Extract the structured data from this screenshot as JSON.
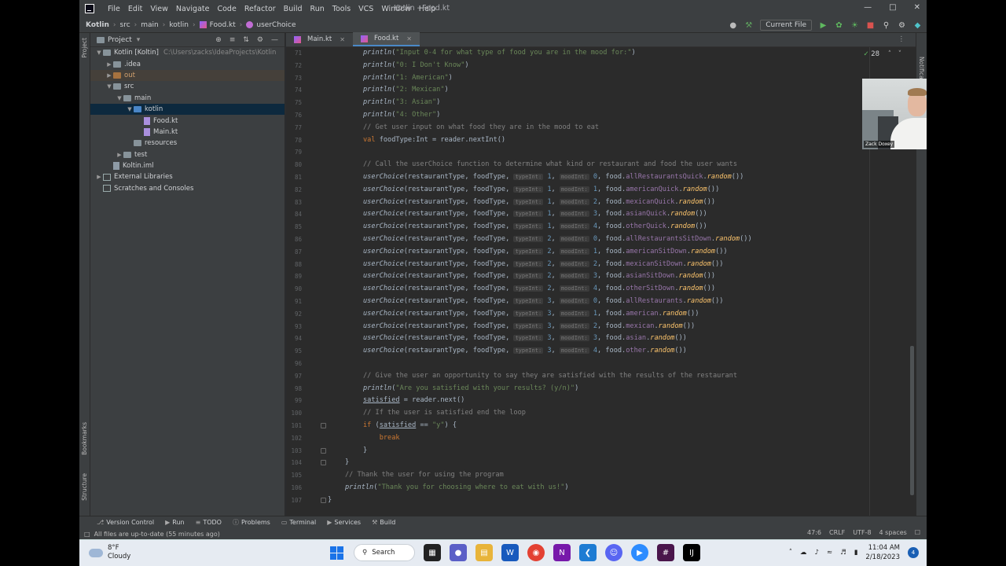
{
  "titlebar": {
    "menus": [
      "File",
      "Edit",
      "View",
      "Navigate",
      "Code",
      "Refactor",
      "Build",
      "Run",
      "Tools",
      "VCS",
      "Window",
      "Help"
    ],
    "window_title": "Kotlin - Food.kt"
  },
  "navbar": {
    "breadcrumbs": [
      "Kotlin",
      "src",
      "main",
      "kotlin",
      "Food.kt",
      "userChoice"
    ],
    "run_config": "Current File"
  },
  "project": {
    "header": "Project",
    "tree": [
      {
        "label": "Kotlin [Koltin]",
        "path": "C:\\Users\\zacks\\IdeaProjects\\Kotlin",
        "level": 0,
        "arrow": "open",
        "icon": "folder"
      },
      {
        "label": ".idea",
        "level": 1,
        "arrow": "closed",
        "icon": "folder"
      },
      {
        "label": "out",
        "level": 1,
        "arrow": "closed",
        "icon": "folder-orange"
      },
      {
        "label": "src",
        "level": 1,
        "arrow": "open",
        "icon": "folder"
      },
      {
        "label": "main",
        "level": 2,
        "arrow": "open",
        "icon": "folder"
      },
      {
        "label": "kotlin",
        "level": 3,
        "arrow": "open",
        "icon": "folder-blue"
      },
      {
        "label": "Food.kt",
        "level": 4,
        "arrow": "none",
        "icon": "kt"
      },
      {
        "label": "Main.kt",
        "level": 4,
        "arrow": "none",
        "icon": "kt"
      },
      {
        "label": "resources",
        "level": 3,
        "arrow": "none",
        "icon": "folder"
      },
      {
        "label": "test",
        "level": 2,
        "arrow": "closed",
        "icon": "folder"
      },
      {
        "label": "Koltin.iml",
        "level": 1,
        "arrow": "none",
        "icon": "iml"
      },
      {
        "label": "External Libraries",
        "level": 0,
        "arrow": "closed",
        "icon": "lib"
      },
      {
        "label": "Scratches and Consoles",
        "level": 0,
        "arrow": "none",
        "icon": "lib"
      }
    ]
  },
  "tabs": [
    {
      "label": "Main.kt",
      "active": false
    },
    {
      "label": "Food.kt",
      "active": true
    }
  ],
  "editor": {
    "inspection_count": "28",
    "lines": [
      {
        "n": "71",
        "html": "<span class='fn'>println</span>(<span class='str'>\"Input 0-4 for what type of food you are in the mood for:\"</span>)"
      },
      {
        "n": "72",
        "html": "<span class='fn'>println</span>(<span class='str'>\"0: I Don't Know\"</span>)"
      },
      {
        "n": "73",
        "html": "<span class='fn'>println</span>(<span class='str'>\"1: American\"</span>)"
      },
      {
        "n": "74",
        "html": "<span class='fn'>println</span>(<span class='str'>\"2: Mexican\"</span>)"
      },
      {
        "n": "75",
        "html": "<span class='fn'>println</span>(<span class='str'>\"3: Asian\"</span>)"
      },
      {
        "n": "76",
        "html": "<span class='fn'>println</span>(<span class='str'>\"4: Other\"</span>)"
      },
      {
        "n": "77",
        "html": "<span class='cmt'>// Get user input on what food they are in the mood to eat</span>"
      },
      {
        "n": "78",
        "html": "<span class='kw'>val</span> foodType:Int = reader.nextInt()"
      },
      {
        "n": "79",
        "html": ""
      },
      {
        "n": "80",
        "html": "<span class='cmt'>// Call the userChoice function to determine what kind or restaurant and food the user wants</span>"
      },
      {
        "n": "81",
        "html": "<span class='fn'>userChoice</span>(restaurantType, foodType, <span class='hint'>typeInt:</span> <span class='num'>1</span>, <span class='hint'>moodInt:</span> <span class='num'>0</span>, food.<span class='prop'>allRestaurantsQuick</span>.<span class='ext'>random</span>())"
      },
      {
        "n": "82",
        "html": "<span class='fn'>userChoice</span>(restaurantType, foodType, <span class='hint'>typeInt:</span> <span class='num'>1</span>, <span class='hint'>moodInt:</span> <span class='num'>1</span>, food.<span class='prop'>americanQuick</span>.<span class='ext'>random</span>())"
      },
      {
        "n": "83",
        "html": "<span class='fn'>userChoice</span>(restaurantType, foodType, <span class='hint'>typeInt:</span> <span class='num'>1</span>, <span class='hint'>moodInt:</span> <span class='num'>2</span>, food.<span class='prop'>mexicanQuick</span>.<span class='ext'>random</span>())"
      },
      {
        "n": "84",
        "html": "<span class='fn'>userChoice</span>(restaurantType, foodType, <span class='hint'>typeInt:</span> <span class='num'>1</span>, <span class='hint'>moodInt:</span> <span class='num'>3</span>, food.<span class='prop'>asianQuick</span>.<span class='ext'>random</span>())"
      },
      {
        "n": "85",
        "html": "<span class='fn'>userChoice</span>(restaurantType, foodType, <span class='hint'>typeInt:</span> <span class='num'>1</span>, <span class='hint'>moodInt:</span> <span class='num'>4</span>, food.<span class='prop'>otherQuick</span>.<span class='ext'>random</span>())"
      },
      {
        "n": "86",
        "html": "<span class='fn'>userChoice</span>(restaurantType, foodType, <span class='hint'>typeInt:</span> <span class='num'>2</span>, <span class='hint'>moodInt:</span> <span class='num'>0</span>, food.<span class='prop'>allRestaurantsSitDown</span>.<span class='ext'>random</span>())"
      },
      {
        "n": "87",
        "html": "<span class='fn'>userChoice</span>(restaurantType, foodType, <span class='hint'>typeInt:</span> <span class='num'>2</span>, <span class='hint'>moodInt:</span> <span class='num'>1</span>, food.<span class='prop'>americanSitDown</span>.<span class='ext'>random</span>())"
      },
      {
        "n": "88",
        "html": "<span class='fn'>userChoice</span>(restaurantType, foodType, <span class='hint'>typeInt:</span> <span class='num'>2</span>, <span class='hint'>moodInt:</span> <span class='num'>2</span>, food.<span class='prop'>mexicanSitDown</span>.<span class='ext'>random</span>())"
      },
      {
        "n": "89",
        "html": "<span class='fn'>userChoice</span>(restaurantType, foodType, <span class='hint'>typeInt:</span> <span class='num'>2</span>, <span class='hint'>moodInt:</span> <span class='num'>3</span>, food.<span class='prop'>asianSitDown</span>.<span class='ext'>random</span>())"
      },
      {
        "n": "90",
        "html": "<span class='fn'>userChoice</span>(restaurantType, foodType, <span class='hint'>typeInt:</span> <span class='num'>2</span>, <span class='hint'>moodInt:</span> <span class='num'>4</span>, food.<span class='prop'>otherSitDown</span>.<span class='ext'>random</span>())"
      },
      {
        "n": "91",
        "html": "<span class='fn'>userChoice</span>(restaurantType, foodType, <span class='hint'>typeInt:</span> <span class='num'>3</span>, <span class='hint'>moodInt:</span> <span class='num'>0</span>, food.<span class='prop'>allRestaurants</span>.<span class='ext'>random</span>())"
      },
      {
        "n": "92",
        "html": "<span class='fn'>userChoice</span>(restaurantType, foodType, <span class='hint'>typeInt:</span> <span class='num'>3</span>, <span class='hint'>moodInt:</span> <span class='num'>1</span>, food.<span class='prop'>american</span>.<span class='ext'>random</span>())"
      },
      {
        "n": "93",
        "html": "<span class='fn'>userChoice</span>(restaurantType, foodType, <span class='hint'>typeInt:</span> <span class='num'>3</span>, <span class='hint'>moodInt:</span> <span class='num'>2</span>, food.<span class='prop'>mexican</span>.<span class='ext'>random</span>())"
      },
      {
        "n": "94",
        "html": "<span class='fn'>userChoice</span>(restaurantType, foodType, <span class='hint'>typeInt:</span> <span class='num'>3</span>, <span class='hint'>moodInt:</span> <span class='num'>3</span>, food.<span class='prop'>asian</span>.<span class='ext'>random</span>())"
      },
      {
        "n": "95",
        "html": "<span class='fn'>userChoice</span>(restaurantType, foodType, <span class='hint'>typeInt:</span> <span class='num'>3</span>, <span class='hint'>moodInt:</span> <span class='num'>4</span>, food.<span class='prop'>other</span>.<span class='ext'>random</span>())"
      },
      {
        "n": "96",
        "html": ""
      },
      {
        "n": "97",
        "html": "<span class='cmt'>// Give the user an opportunity to say they are satisfied with the results of the restaurant</span>"
      },
      {
        "n": "98",
        "html": "<span class='fn'>println</span>(<span class='str'>\"Are you satisfied with your results? (y/n)\"</span>)"
      },
      {
        "n": "99",
        "html": "<span class='underl'>satisfied</span> = reader.next()"
      },
      {
        "n": "100",
        "html": "<span class='cmt'>// If the user is satisfied end the loop</span>"
      },
      {
        "n": "101",
        "html": "<span class='kw'>if</span> (<span class='underl'>satisfied</span> == <span class='str'>\"y\"</span>) {"
      },
      {
        "n": "102",
        "html": "    <span class='kw'>break</span>"
      },
      {
        "n": "103",
        "html": "}"
      },
      {
        "n": "104",
        "html": "}"
      },
      {
        "n": "105",
        "html": "<span class='cmt'>// Thank the user for using the program</span>"
      },
      {
        "n": "106",
        "html": "<span class='fn'>println</span>(<span class='str'>\"Thank you for choosing where to eat with us!\"</span>)"
      },
      {
        "n": "107",
        "html": "}"
      }
    ]
  },
  "webcam": {
    "name": "Zack Doxey"
  },
  "bottom_tools": [
    "Version Control",
    "Run",
    "TODO",
    "Problems",
    "Terminal",
    "Services",
    "Build"
  ],
  "status": {
    "message": "All files are up-to-date (55 minutes ago)",
    "position": "47:6",
    "line_sep": "CRLF",
    "encoding": "UTF-8",
    "indent": "4 spaces"
  },
  "taskbar": {
    "temp": "8°F",
    "weather": "Cloudy",
    "search": "Search",
    "time": "11:04 AM",
    "date": "2/18/2023",
    "notifications": "4"
  },
  "strips": {
    "project": "Project",
    "bookmarks": "Bookmarks",
    "structure": "Structure",
    "notifications": "Notifications"
  }
}
